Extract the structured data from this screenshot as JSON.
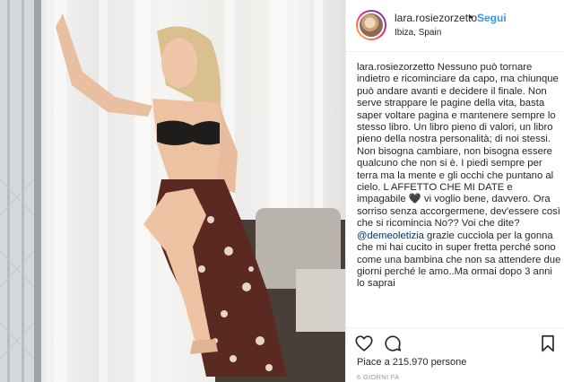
{
  "post": {
    "username": "lara.rosiezorzetto",
    "separator": "•",
    "follow_label": "Segui",
    "location": "Ibiza, Spain",
    "caption_user": "lara.rosiezorzetto",
    "caption_part1": " Nessuno può tornare indietro e ricominciare da capo, ma chiunque può andare avanti e decidere il finale.  Non serve strappare le pagine della vita, basta saper voltare pagina e mantenere sempre lo stesso libro. Un libro pieno di valori, un libro pieno della nostra personalità; di noi stessi. Non bisogna cambiare, non bisogna essere qualcuno che non si è. I piedi sempre per terra ma la mente e gli occhi che puntano al cielo. L AFFETTO CHE MI DATE e impagabile 🖤 vi voglio bene, davvero. Ora sorriso senza accorgermene, dev'essere così che si ricomincia No?? Voi che dite? ",
    "caption_mention": "@demeoletizia",
    "caption_part2": " grazie cucciola per la gonna che mi hai cucito in super fretta perché sono come una bambina che non sa attendere due giorni perché le amo..Ma ormai dopo 3 anni lo saprai",
    "likes_text": "Piace a 215.970 persone",
    "time_text": "6 GIORNI FA"
  },
  "icons": {
    "like": "heart-icon",
    "comment": "comment-icon",
    "save": "bookmark-icon"
  },
  "colors": {
    "link_blue": "#3897f0",
    "mention_blue": "#003569",
    "text": "#262626",
    "muted": "#999999",
    "border": "#efefef"
  }
}
